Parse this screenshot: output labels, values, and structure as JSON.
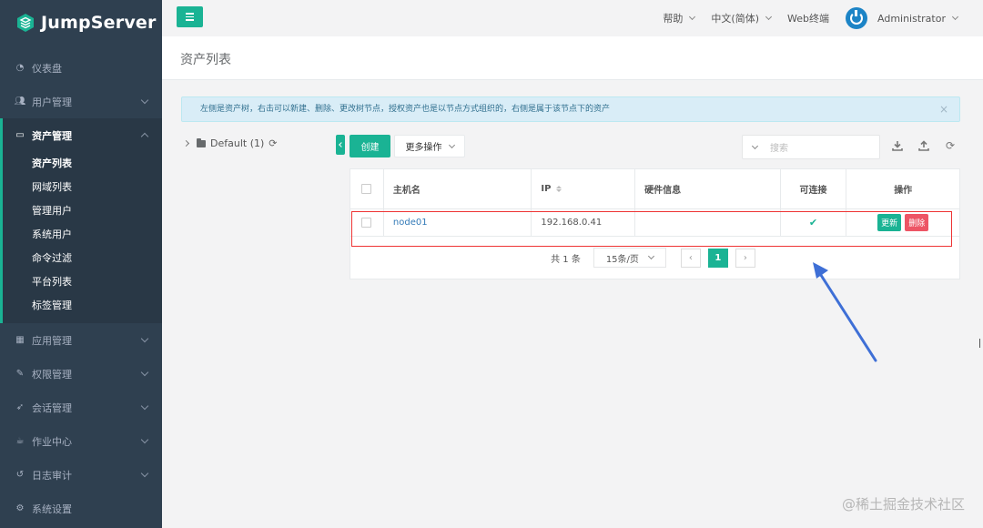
{
  "app": {
    "logo_text": "JumpServer",
    "accent_color": "#1ab394",
    "sidebar_color": "#2f4050"
  },
  "sidebar": {
    "items": [
      {
        "label": "仪表盘",
        "icon": "dashboard-icon"
      },
      {
        "label": "用户管理",
        "icon": "users-icon"
      },
      {
        "label": "资产管理",
        "icon": "hdd-icon"
      },
      {
        "label": "应用管理",
        "icon": "th-icon"
      },
      {
        "label": "权限管理",
        "icon": "edit-icon"
      },
      {
        "label": "会话管理",
        "icon": "rocket-icon"
      },
      {
        "label": "作业中心",
        "icon": "coffee-icon"
      },
      {
        "label": "日志审计",
        "icon": "history-icon"
      },
      {
        "label": "系统设置",
        "icon": "gears-icon"
      }
    ],
    "asset_sub": [
      "资产列表",
      "网域列表",
      "管理用户",
      "系统用户",
      "命令过滤",
      "平台列表",
      "标签管理"
    ]
  },
  "topbar": {
    "help": "帮助",
    "language": "中文(简体)",
    "web_terminal": "Web终端",
    "user": "Administrator"
  },
  "page": {
    "title": "资产列表",
    "alert": "左侧是资产树，右击可以新建、删除、更改树节点，授权资产也是以节点方式组织的，右侧是属于该节点下的资产",
    "alert_close": "×"
  },
  "tree": {
    "root_label": "Default (1)"
  },
  "toolbar": {
    "create": "创建",
    "more": "更多操作",
    "search_placeholder": "搜索"
  },
  "table": {
    "headers": [
      "主机名",
      "IP",
      "硬件信息",
      "可连接",
      "操作"
    ],
    "rows": [
      {
        "hostname": "node01",
        "ip": "192.168.0.41",
        "hardware": "",
        "connectable": "✔",
        "update": "更新",
        "delete": "删除"
      }
    ]
  },
  "pagination": {
    "total": "共 1 条",
    "page_size": "15条/页",
    "prev": "‹",
    "current": "1",
    "next": "›"
  },
  "watermark": "@稀土掘金技术社区"
}
